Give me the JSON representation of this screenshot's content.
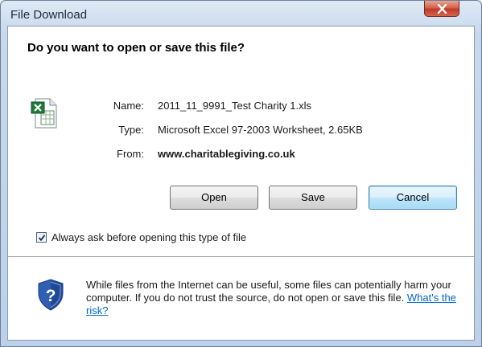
{
  "window": {
    "title": "File Download",
    "close_label": "x"
  },
  "dialog": {
    "heading": "Do you want to open or save this file?",
    "file_icon": "excel-file-icon",
    "info": {
      "name_label": "Name:",
      "name_value": "2011_11_9991_Test Charity 1.xls",
      "type_label": "Type:",
      "type_value": "Microsoft Excel 97-2003 Worksheet, 2.65KB",
      "from_label": "From:",
      "from_value": "www.charitablegiving.co.uk"
    },
    "buttons": {
      "open": "Open",
      "save": "Save",
      "cancel": "Cancel"
    },
    "checkbox": {
      "label": "Always ask before opening this type of file",
      "checked": true
    },
    "warning": {
      "icon": "shield-question-icon",
      "text": "While files from the Internet can be useful, some files can potentially harm your computer. If you do not trust the source, do not open or save this file.",
      "link": "What's the risk?"
    }
  },
  "colors": {
    "link": "#0066cc",
    "close_button": "#c0392b",
    "titlebar": "#c9d9ec"
  }
}
